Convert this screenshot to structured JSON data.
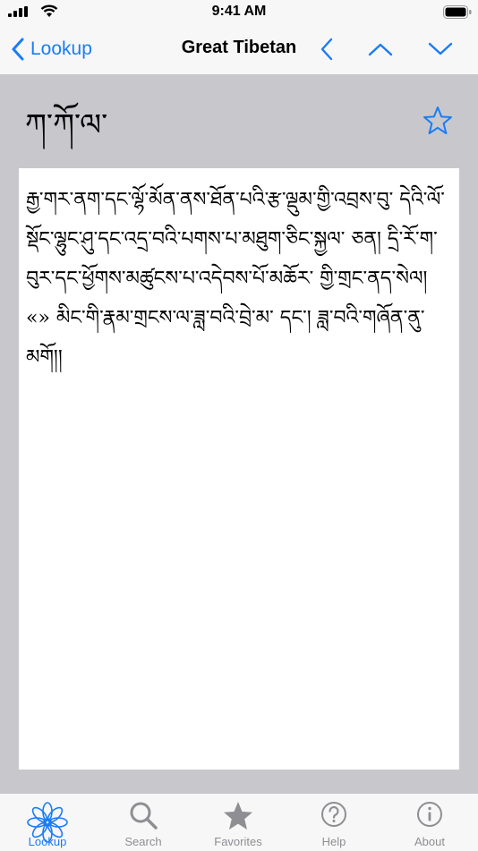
{
  "status_bar": {
    "time": "9:41 AM"
  },
  "nav": {
    "back_label": "Lookup",
    "title": "Great Tibetan",
    "icons": [
      "chevron-left-icon",
      "chevron-up-icon",
      "chevron-down-icon"
    ],
    "accent_color": "#1a7cf5"
  },
  "entry": {
    "headword": "ཀ་ཀོ་ལ་",
    "favorite_icon": "star-outline-icon",
    "definition": "རྒྱ་གར་ནག་དང་ལྷོ་མོན་ནས་ཐོན་པའི་རྩ་ལྡུམ་གྱི་འབྲས་བུ་ དེའི་ལོ་སྡོང་ལྷུང་ཤུ་དང་འདྲ་བའི་པགས་པ་མཐུག་ཅིང་སྐྱལ་ ཅན།   དྲི་རོ་ག་བུར་དང་ཕྱོགས་མཚུངས་པ་འདེབས་པོ་མཆོར་ གྱི་གྲང་ནད་སེལ། «» མིང་གི་རྣམ་གྲངས་ལ་ཟླ་བའི་བྲེ་མ་ དང་།   ཟླ་བའི་གཞོན་ནུ་མགོ།།"
  },
  "tab_bar": {
    "tabs": [
      {
        "label": "Lookup",
        "icon": "lotus-icon",
        "active": true
      },
      {
        "label": "Search",
        "icon": "search-icon",
        "active": false
      },
      {
        "label": "Favorites",
        "icon": "star-icon",
        "active": false
      },
      {
        "label": "Help",
        "icon": "question-circle-icon",
        "active": false
      },
      {
        "label": "About",
        "icon": "info-circle-icon",
        "active": false
      }
    ],
    "active_color": "#1a7cf5",
    "inactive_color": "#8e8e93"
  }
}
